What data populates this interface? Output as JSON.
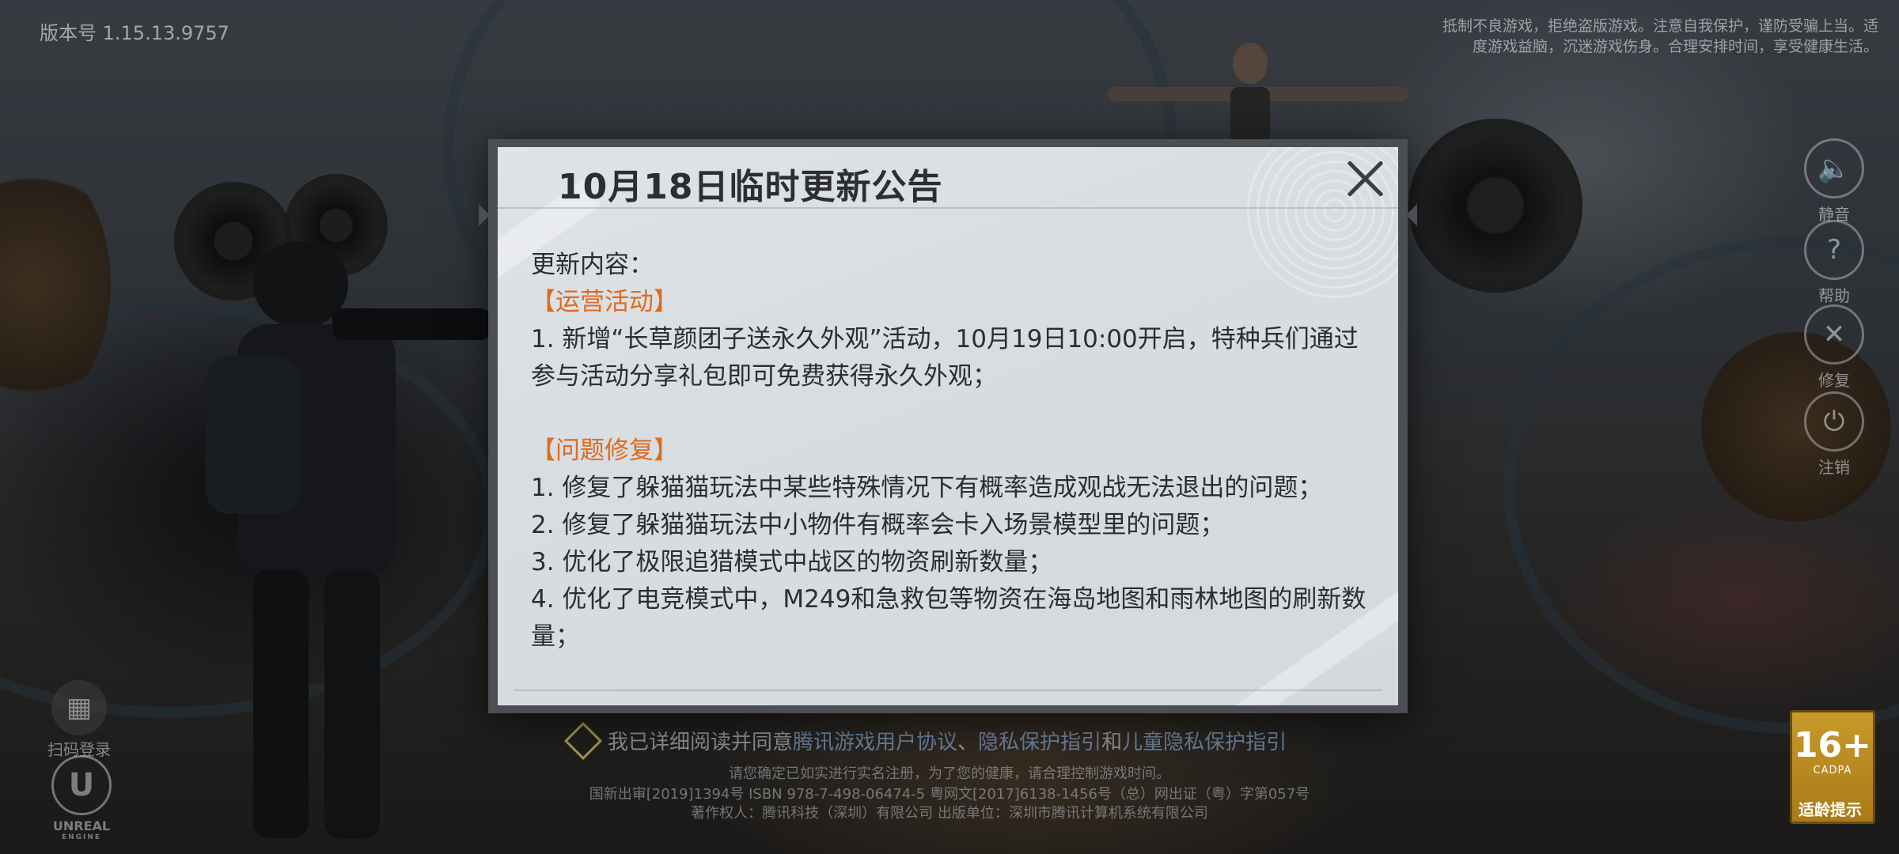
{
  "version": "版本号 1.15.13.9757",
  "health_notice": "抵制不良游戏，拒绝盗版游戏。注意自我保护，谨防受骗上当。适度游戏益脑，沉迷游戏伤身。合理安排时间，享受健康生活。",
  "side_buttons": [
    {
      "label": "静音",
      "icon": "speaker-icon",
      "glyph": "🔈"
    },
    {
      "label": "帮助",
      "icon": "help-icon",
      "glyph": "?"
    },
    {
      "label": "修复",
      "icon": "repair-icon",
      "glyph": "✕"
    },
    {
      "label": "注销",
      "icon": "power-icon",
      "glyph": "⏻"
    }
  ],
  "qr_login": {
    "label": "扫码登录",
    "glyph": "▦"
  },
  "unreal": {
    "label": "UNREAL",
    "sub": "ENGINE",
    "glyph": "U"
  },
  "agreement": {
    "prefix": "我已详细阅读并同意",
    "link1": "腾讯游戏用户协议",
    "sep1": "、",
    "link2": "隐私保护指引",
    "sep2": "和",
    "link3": "儿童隐私保护指引"
  },
  "footer": {
    "line1": "请您确定已如实进行实名注册，为了您的健康，请合理控制游戏时间。",
    "line2": "国新出审[2019]1394号 ISBN 978-7-498-06474-5 粤网文[2017]6138-1456号（总）网出证（粤）字第057号",
    "line3": "著作权人：腾讯科技（深圳）有限公司 出版单位：深圳市腾讯计算机系统有限公司"
  },
  "age_rating": {
    "number": "16+",
    "tag": "CADPA",
    "label": "适龄提示"
  },
  "dialog": {
    "title": "10月18日临时更新公告",
    "intro": "更新内容：",
    "section1": "【运营活动】",
    "s1_items": [
      "1. 新增“长草颜团子送永久外观”活动，10月19日10:00开启，特种兵们通过参与活动分享礼包即可免费获得永久外观；"
    ],
    "section2": "【问题修复】",
    "s2_items": [
      "1. 修复了躲猫猫玩法中某些特殊情况下有概率造成观战无法退出的问题；",
      "2. 修复了躲猫猫玩法中小物件有概率会卡入场景模型里的问题；",
      "3. 优化了极限追猎模式中战区的物资刷新数量；",
      "4. 优化了电竞模式中，M249和急救包等物资在海岛地图和雨林地图的刷新数量；"
    ]
  }
}
